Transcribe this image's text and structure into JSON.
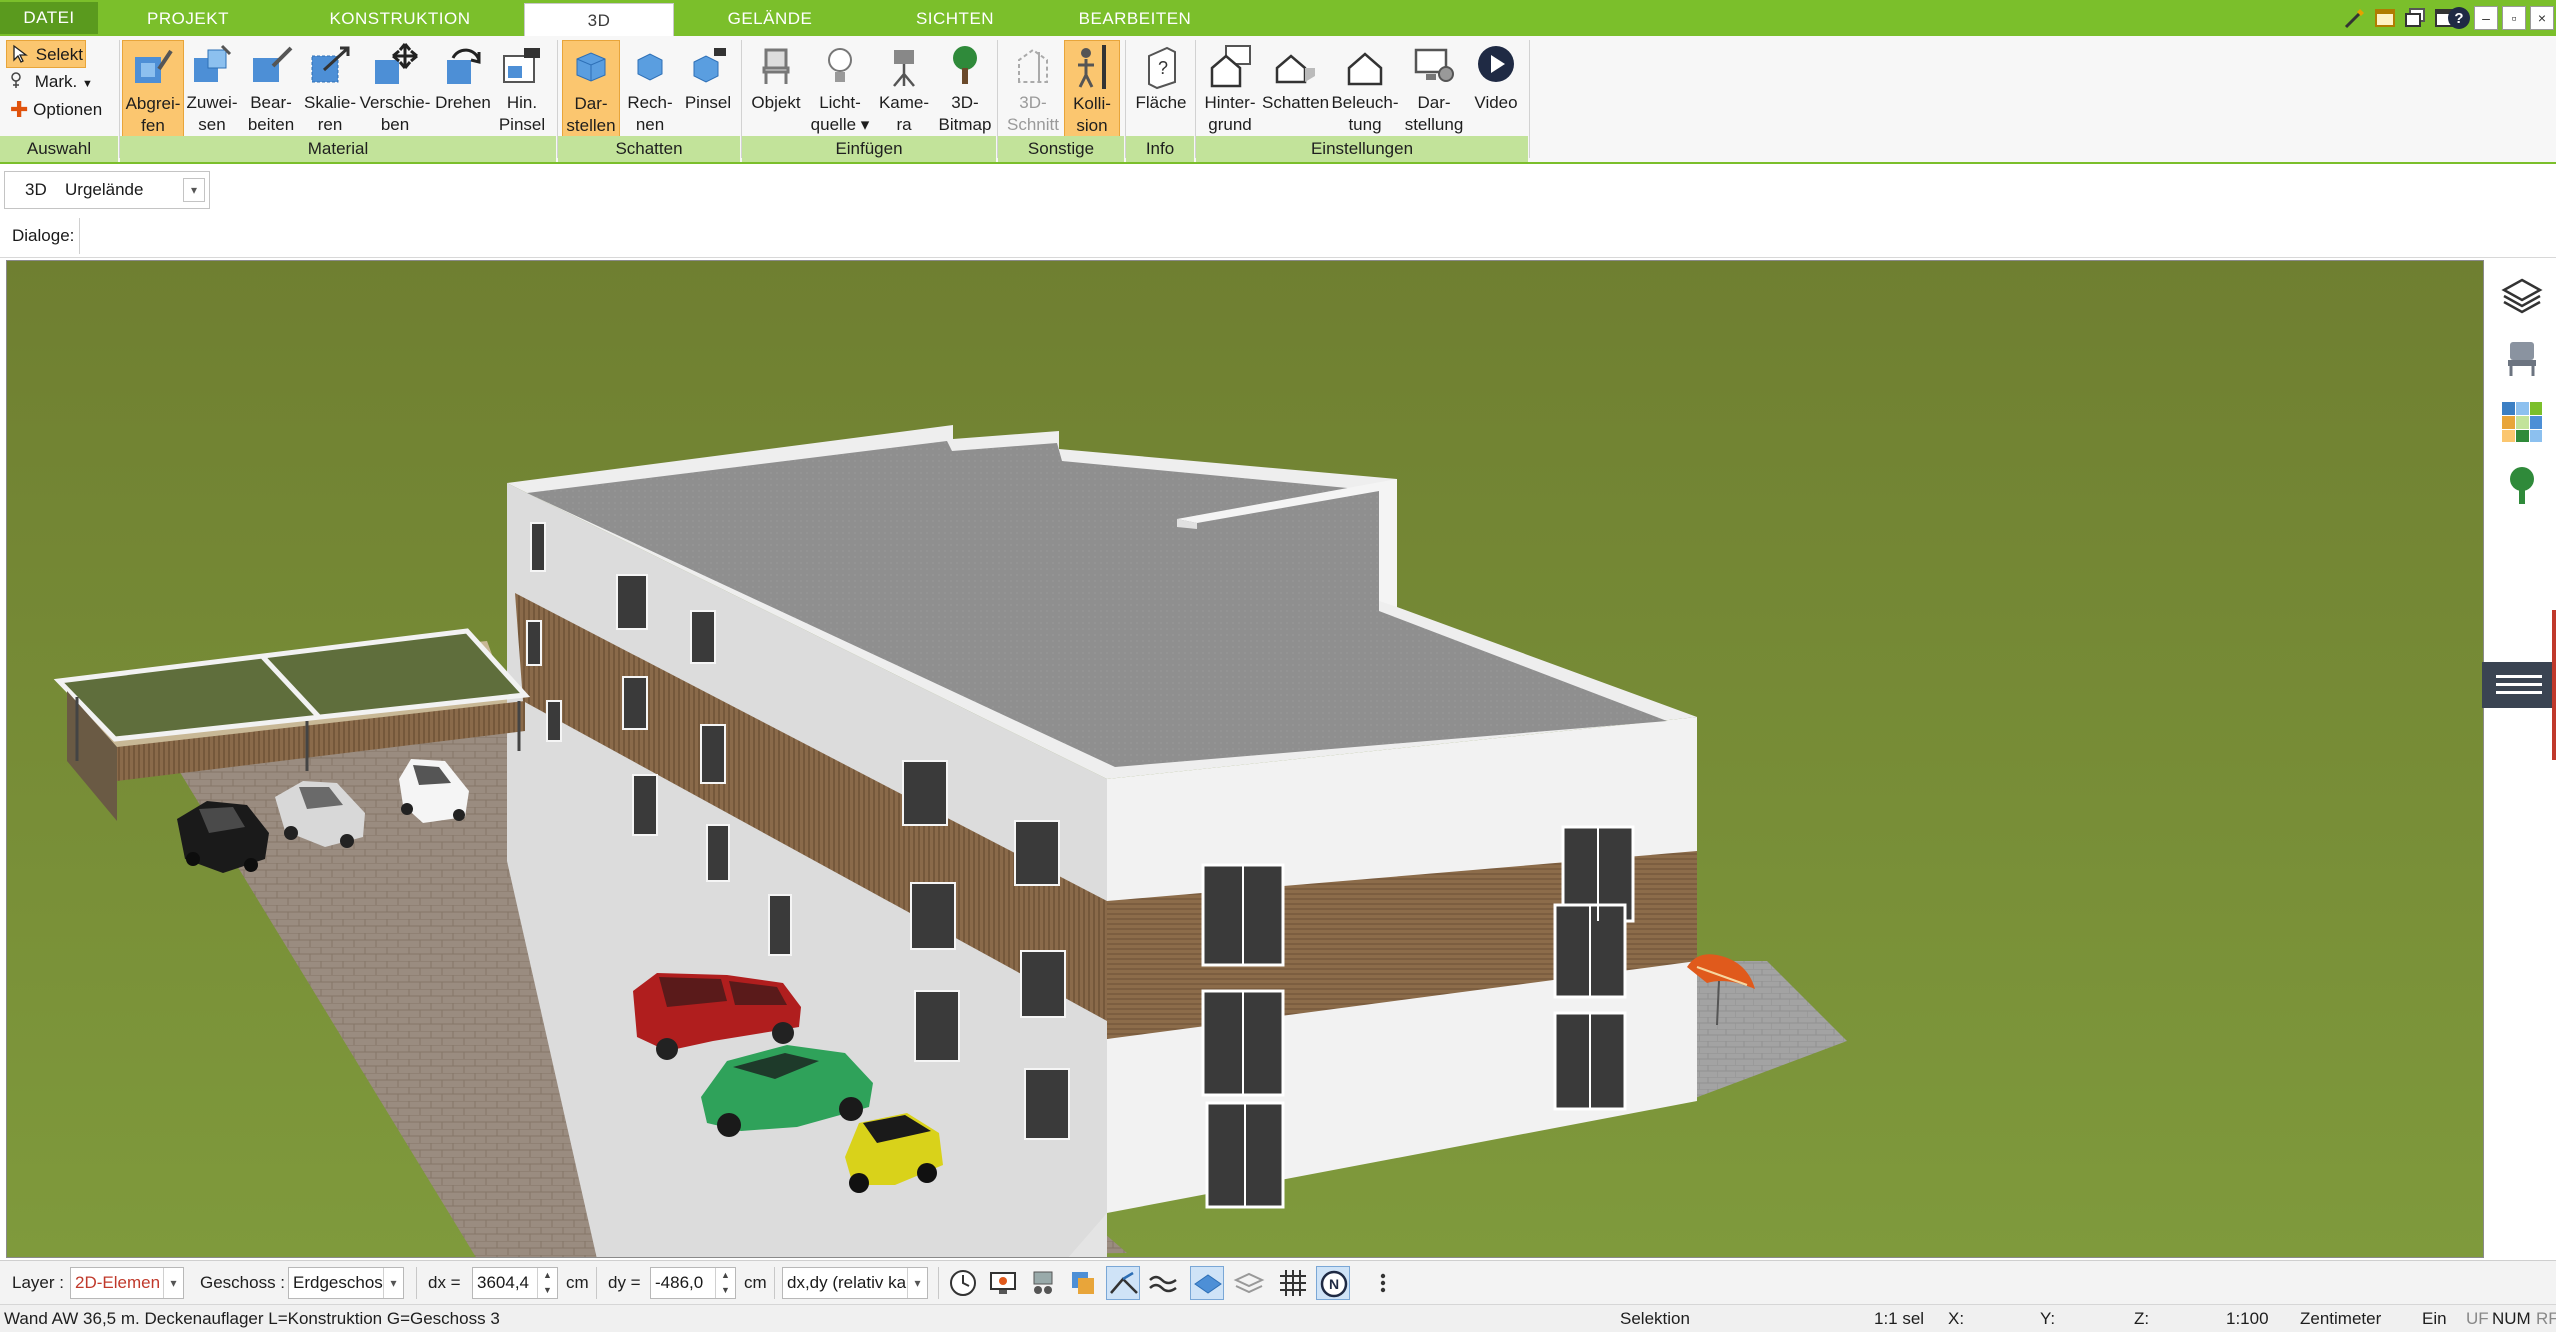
{
  "tabs": [
    {
      "label": "DATEI"
    },
    {
      "label": "PROJEKT"
    },
    {
      "label": "KONSTRUKTION"
    },
    {
      "label": "3D"
    },
    {
      "label": "GELÄNDE"
    },
    {
      "label": "SICHTEN"
    },
    {
      "label": "BEARBEITEN"
    }
  ],
  "titlebar_icons": [
    "wand-icon",
    "window-layout-icon",
    "window-restore-icon",
    "window-icon",
    "help-icon"
  ],
  "window_buttons": [
    "–",
    "▫",
    "×"
  ],
  "ribbon": {
    "auswahl": {
      "select_label": "Selekt",
      "mark_label": "Mark.",
      "options_label": "Optionen",
      "group": "Auswahl"
    },
    "material": {
      "group": "Material",
      "buttons": [
        {
          "l1": "Abgrei-",
          "l2": "fen"
        },
        {
          "l1": "Zuwei-",
          "l2": "sen"
        },
        {
          "l1": "Bear-",
          "l2": "beiten"
        },
        {
          "l1": "Skalie-",
          "l2": "ren"
        },
        {
          "l1": "Verschie-",
          "l2": "ben"
        },
        {
          "l1": "Drehen",
          "l2": ""
        },
        {
          "l1": "Hin.",
          "l2": "Pinsel"
        }
      ]
    },
    "schatten": {
      "group": "Schatten",
      "buttons": [
        {
          "l1": "Dar-",
          "l2": "stellen"
        },
        {
          "l1": "Rech-",
          "l2": "nen"
        },
        {
          "l1": "Pinsel",
          "l2": ""
        }
      ]
    },
    "einfuegen": {
      "group": "Einfügen",
      "buttons": [
        {
          "l1": "Objekt",
          "l2": ""
        },
        {
          "l1": "Licht-",
          "l2": "quelle ▾"
        },
        {
          "l1": "Kame-",
          "l2": "ra"
        },
        {
          "l1": "3D-",
          "l2": "Bitmap"
        }
      ]
    },
    "sonstige": {
      "group": "Sonstige",
      "buttons": [
        {
          "l1": "3D-",
          "l2": "Schnitt"
        },
        {
          "l1": "Kolli-",
          "l2": "sion"
        }
      ]
    },
    "info": {
      "group": "Info",
      "buttons": [
        {
          "l1": "Fläche",
          "l2": ""
        }
      ]
    },
    "einstellungen": {
      "group": "Einstellungen",
      "buttons": [
        {
          "l1": "Hinter-",
          "l2": "grund"
        },
        {
          "l1": "Schatten",
          "l2": ""
        },
        {
          "l1": "Beleuch-",
          "l2": "tung"
        },
        {
          "l1": "Dar-",
          "l2": "stellung"
        },
        {
          "l1": "Video",
          "l2": ""
        }
      ]
    }
  },
  "row1": {
    "mode_label": "3D",
    "terrain_value": "Urgelände"
  },
  "row2": {
    "dialogs_label": "Dialoge:"
  },
  "right_panel_icons": [
    "layers-icon",
    "furniture-icon",
    "materials-icon",
    "tree-icon",
    "menu-icon"
  ],
  "bottombar": {
    "layer_label": "Layer :",
    "layer_value": "2D-Elemen",
    "floor_label": "Geschoss :",
    "floor_value": "Erdgeschos",
    "dx_label": "dx =",
    "dx_value": "3604,4",
    "dx_unit": "cm",
    "dy_label": "dy =",
    "dy_value": "-486,0",
    "dy_unit": "cm",
    "mode_value": "dx,dy (relativ ka",
    "tool_icons": [
      "clock-icon",
      "screen-icon",
      "walk-icon",
      "copy-icon",
      "snap-icon",
      "wave-icon",
      "plane-icon",
      "layers-flat-icon",
      "grid-icon",
      "north-icon",
      "more-icon"
    ]
  },
  "statusbar": {
    "message": "Wand AW 36,5 m. Deckenauflager L=Konstruktion G=Geschoss 3",
    "mode": "Selektion",
    "selection": "1:1 sel",
    "x": "X:",
    "y": "Y:",
    "z": "Z:",
    "scale": "1:100",
    "unit": "Zentimeter",
    "ein": "Ein",
    "uf": "UF",
    "num": "NUM",
    "rf": "RF"
  },
  "colors": {
    "accent_green": "#7bbf2b",
    "group_green": "#c2e39a",
    "highlight_orange": "#fbc66f",
    "grass": "#7a8a36"
  }
}
